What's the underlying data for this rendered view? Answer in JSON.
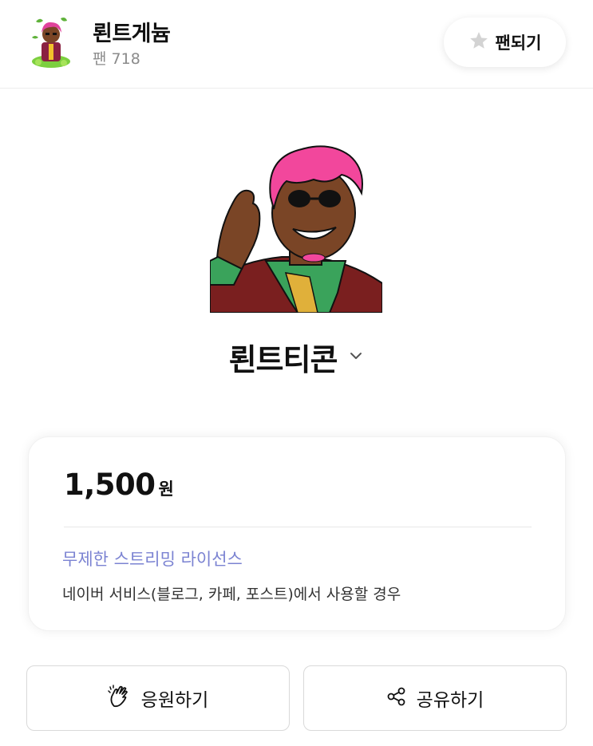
{
  "header": {
    "creator_name": "뢴트게늄",
    "fan_count": "팬 718",
    "fan_button_label": "팬되기"
  },
  "pack": {
    "title": "뢴트티콘"
  },
  "price_card": {
    "amount": "1,500",
    "unit": "원",
    "license_title": "무제한 스트리밍 라이선스",
    "license_desc": "네이버 서비스(블로그, 카페, 포스트)에서 사용할 경우"
  },
  "actions": {
    "support_label": "응원하기",
    "share_label": "공유하기"
  },
  "icons": {
    "fan_star": "star-icon",
    "title_toggle": "chevron-down-icon",
    "support": "clapping-hands-icon",
    "share": "share-icon"
  },
  "colors": {
    "license_accent": "#7b83d2",
    "star_gray": "#d3d3d3",
    "sticker_hair": "#f2479c"
  }
}
